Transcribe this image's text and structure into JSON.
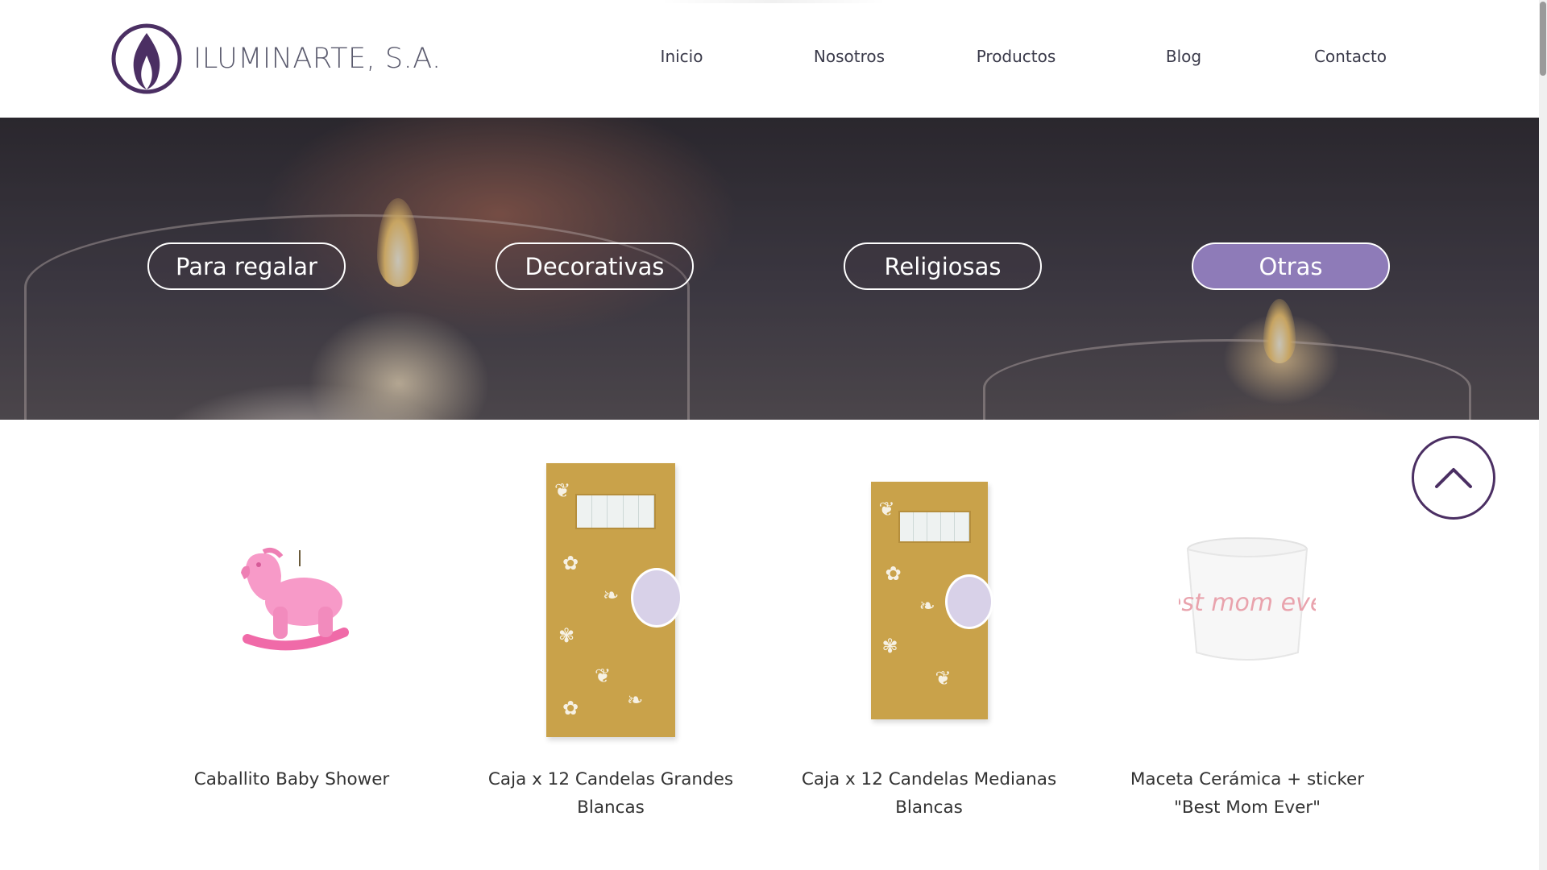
{
  "brand": {
    "name": "ILUMINARTE, S.A.",
    "logo_color": "#4b2f63"
  },
  "nav": [
    {
      "label": "Inicio"
    },
    {
      "label": "Nosotros"
    },
    {
      "label": "Productos"
    },
    {
      "label": "Blog"
    },
    {
      "label": "Contacto"
    }
  ],
  "categories": [
    {
      "label": "Para regalar",
      "active": false
    },
    {
      "label": "Decorativas",
      "active": false
    },
    {
      "label": "Religiosas",
      "active": false
    },
    {
      "label": "Otras",
      "active": true
    }
  ],
  "accent_color": "#8e7bb8",
  "products": [
    {
      "name": "Caballito Baby Shower",
      "image": "pink-rocking-horse-candle"
    },
    {
      "name": "Caja x 12 Candelas Grandes Blancas",
      "image": "gold-floral-candle-box-large"
    },
    {
      "name": "Caja x 12 Candelas Medianas Blancas",
      "image": "gold-floral-candle-box-medium"
    },
    {
      "name": "Maceta Cerámica + sticker \"Best Mom Ever\"",
      "image": "ceramic-pot-best-mom-ever",
      "sticker_text": "Best mom ever!"
    }
  ],
  "scroll_top_icon": "chevron-up-icon"
}
